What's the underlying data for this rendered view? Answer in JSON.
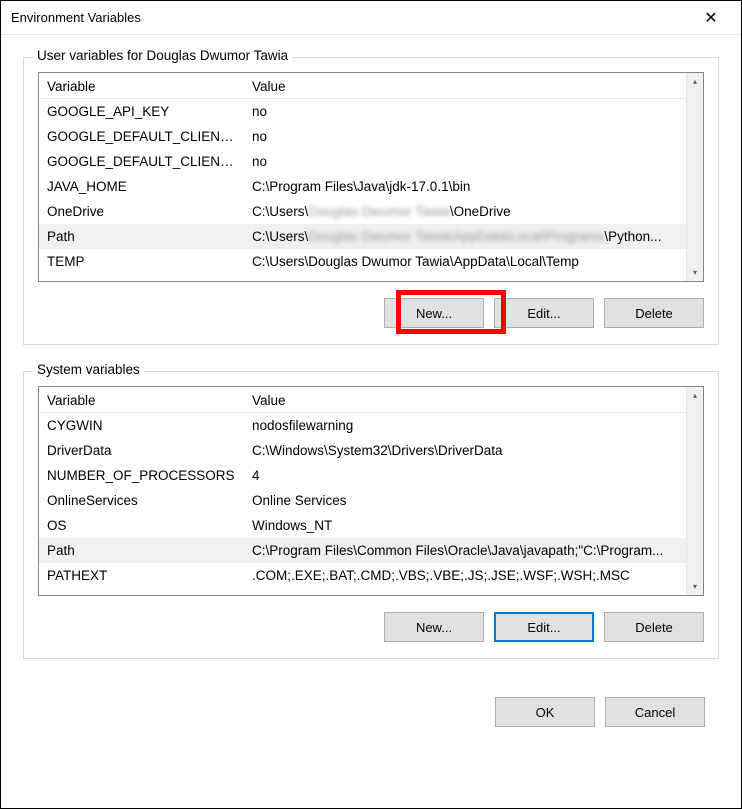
{
  "dialog": {
    "title": "Environment Variables",
    "close_label": "✕"
  },
  "user_section": {
    "title": "User variables for Douglas Dwumor Tawia",
    "columns": {
      "var": "Variable",
      "val": "Value"
    },
    "rows": [
      {
        "name": "GOOGLE_API_KEY",
        "value": "no",
        "selected": false
      },
      {
        "name": "GOOGLE_DEFAULT_CLIENT_ID",
        "value": "no",
        "selected": false
      },
      {
        "name": "GOOGLE_DEFAULT_CLIENT_S...",
        "value": "no",
        "selected": false
      },
      {
        "name": "JAVA_HOME",
        "value": "C:\\Program Files\\Java\\jdk-17.0.1\\bin",
        "selected": false
      },
      {
        "name": "OneDrive",
        "value": "C:\\Users\\Douglas Dwumor Tawia\\OneDrive",
        "blurValue": true,
        "selected": false
      },
      {
        "name": "Path",
        "value": "C:\\Users\\Douglas Dwumor Tawia\\AppData\\Local\\Programs\\Python...",
        "blurValue": true,
        "selected": true
      },
      {
        "name": "TEMP",
        "value": "C:\\Users\\Douglas Dwumor Tawia\\AppData\\Local\\Temp",
        "selected": false
      }
    ],
    "buttons": {
      "new": "New...",
      "edit": "Edit...",
      "del": "Delete"
    }
  },
  "system_section": {
    "title": "System variables",
    "columns": {
      "var": "Variable",
      "val": "Value"
    },
    "rows": [
      {
        "name": "CYGWIN",
        "value": "nodosfilewarning",
        "selected": false
      },
      {
        "name": "DriverData",
        "value": "C:\\Windows\\System32\\Drivers\\DriverData",
        "selected": false
      },
      {
        "name": "NUMBER_OF_PROCESSORS",
        "value": "4",
        "selected": false
      },
      {
        "name": "OnlineServices",
        "value": "Online Services",
        "selected": false
      },
      {
        "name": "OS",
        "value": "Windows_NT",
        "selected": false
      },
      {
        "name": "Path",
        "value": "C:\\Program Files\\Common Files\\Oracle\\Java\\javapath;\"C:\\Program...",
        "selected": true
      },
      {
        "name": "PATHEXT",
        "value": ".COM;.EXE;.BAT;.CMD;.VBS;.VBE;.JS;.JSE;.WSF;.WSH;.MSC",
        "selected": false
      }
    ],
    "buttons": {
      "new": "New...",
      "edit": "Edit...",
      "del": "Delete"
    }
  },
  "footer": {
    "ok": "OK",
    "cancel": "Cancel"
  },
  "scroll": {
    "up": "▴",
    "down": "▾"
  }
}
